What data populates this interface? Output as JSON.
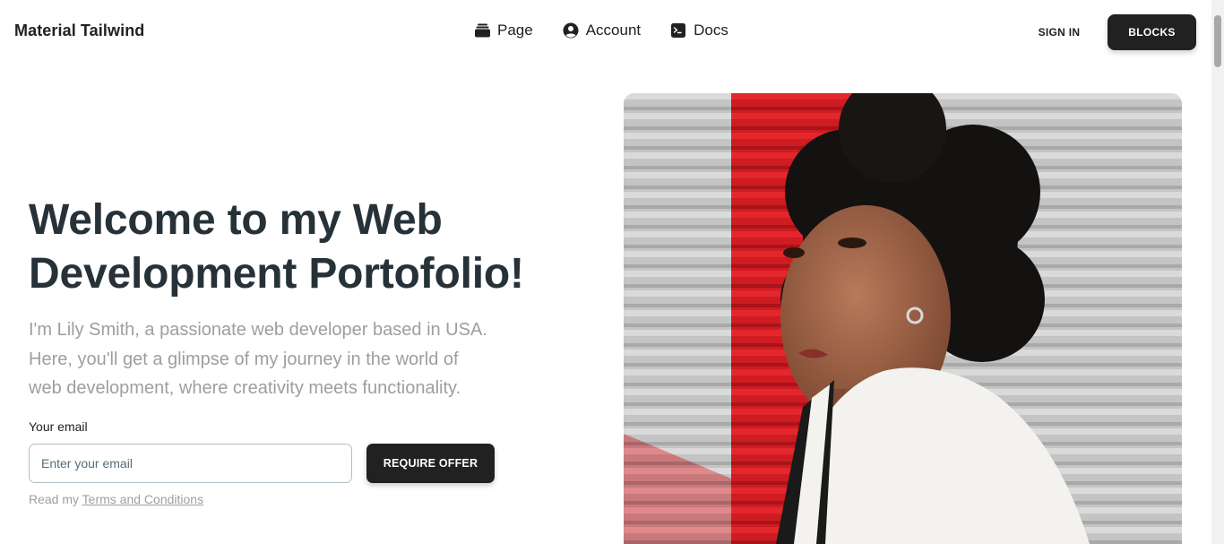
{
  "navbar": {
    "brand": "Material Tailwind",
    "links": [
      {
        "label": "Page",
        "icon": "rectangle-stack-icon"
      },
      {
        "label": "Account",
        "icon": "user-circle-icon"
      },
      {
        "label": "Docs",
        "icon": "command-line-icon"
      }
    ],
    "signin_label": "SIGN IN",
    "blocks_label": "BLOCKS"
  },
  "hero": {
    "title_line1": "Welcome to my Web",
    "title_line2": "Development Portofolio!",
    "description": "I'm Lily Smith, a passionate web developer based in USA. Here, you'll get a glimpse of my journey in the world of web development, where creativity meets functionality.",
    "email_label": "Your email",
    "email_placeholder": "Enter your email",
    "email_value": "",
    "offer_button": "REQUIRE OFFER",
    "terms_prefix": "Read my ",
    "terms_link": "Terms and Conditions"
  },
  "colors": {
    "primary_dark": "#212121",
    "heading": "#263238",
    "muted_text": "#9e9e9e",
    "accent_red": "#d81e24"
  }
}
